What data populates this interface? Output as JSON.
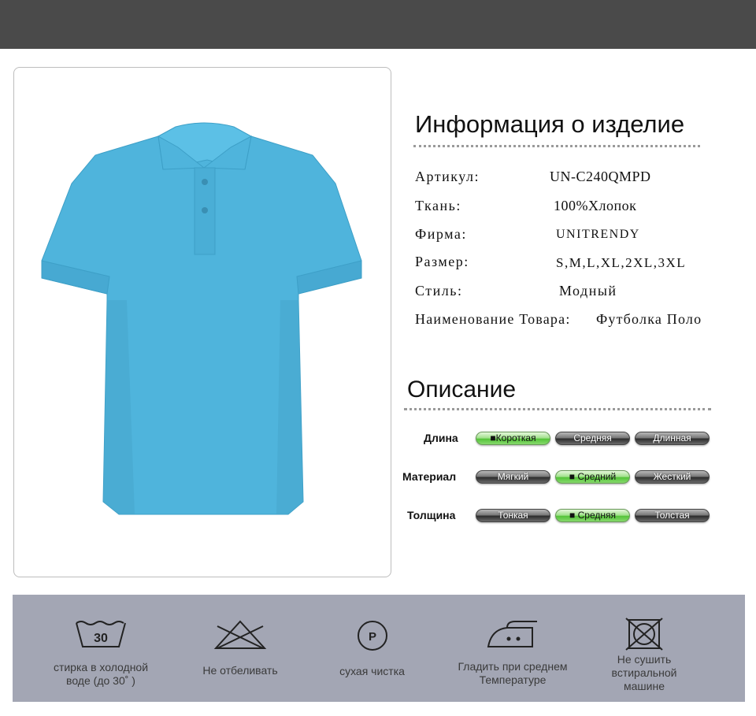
{
  "product": {
    "image_alt": "blue polo shirt",
    "shirt_color": "#4fb4dc"
  },
  "info": {
    "title": "Информация о изделие",
    "specs": [
      {
        "label": "Артикул:",
        "value": "UN-C240QMPD"
      },
      {
        "label": "Ткань:",
        "value": "100%Хлопок"
      },
      {
        "label": "Фирма:",
        "value": "UNITRENDY"
      },
      {
        "label": "Размер:",
        "value": "S,M,L,XL,2XL,3XL"
      },
      {
        "label": "Стиль:",
        "value": "Модный"
      },
      {
        "label": "Наименование Товара:",
        "value": "Футболка Поло"
      }
    ]
  },
  "description": {
    "title": "Описание",
    "rows": [
      {
        "label": "Длина",
        "options": [
          "Короткая",
          "Средняя",
          "Длинная"
        ],
        "selected": "Короткая"
      },
      {
        "label": "Материал",
        "options": [
          "Мягкий",
          "Средний",
          "Жесткий"
        ],
        "selected": "Средний"
      },
      {
        "label": "Толщина",
        "options": [
          "Тонкая",
          "Средняя",
          "Толстая"
        ],
        "selected": "Средняя"
      }
    ],
    "active_color": "#55c43a"
  },
  "care": [
    {
      "icon": "wash-30-icon",
      "number": "30",
      "text": [
        "стирка в холодной",
        "воде (до 30˚ )"
      ]
    },
    {
      "icon": "no-bleach-icon",
      "text": [
        "Не отбеливать"
      ]
    },
    {
      "icon": "dry-clean-p-icon",
      "letter": "P",
      "text": [
        "сухая чистка"
      ]
    },
    {
      "icon": "iron-medium-icon",
      "text": [
        "Гладить при среднем",
        "Температуре"
      ]
    },
    {
      "icon": "no-tumble-dry-icon",
      "text": [
        "Не сушить",
        "встиральной",
        "машине"
      ]
    }
  ]
}
